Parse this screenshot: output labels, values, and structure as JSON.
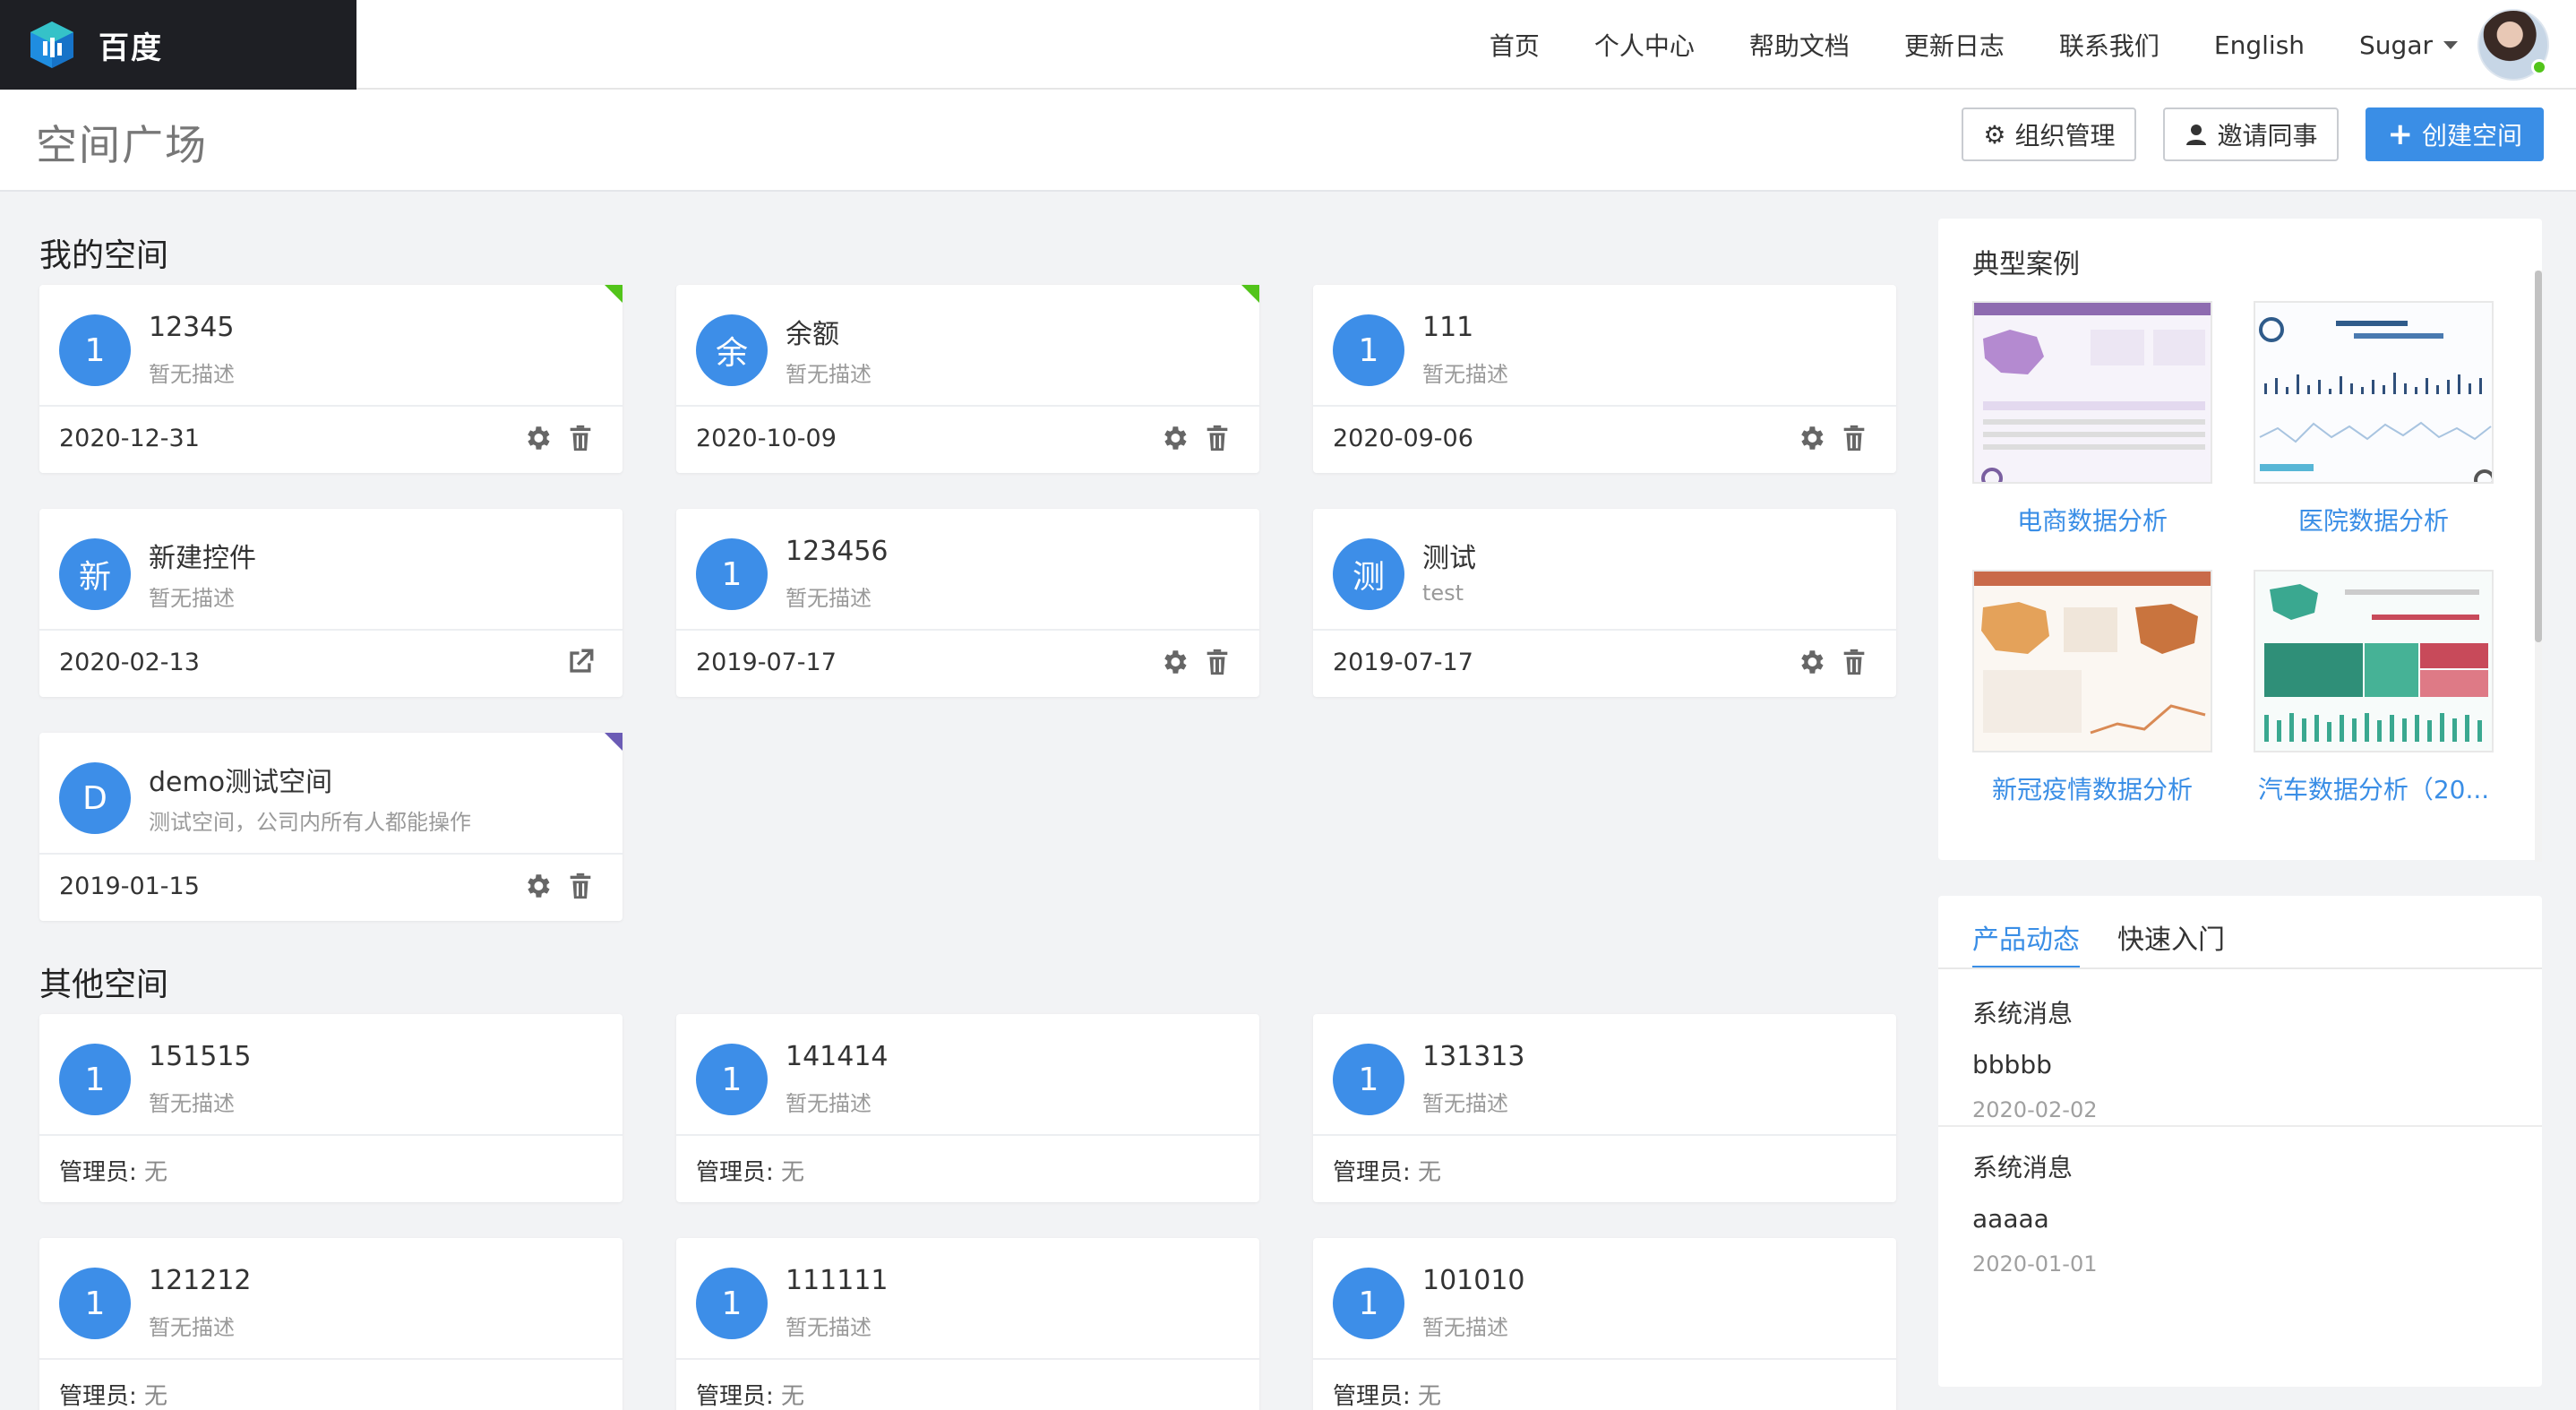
{
  "app": {
    "brand": "百度",
    "nav": [
      "首页",
      "个人中心",
      "帮助文档",
      "更新日志",
      "联系我们",
      "English"
    ],
    "user": "Sugar"
  },
  "header": {
    "title": "空间广场",
    "buttons": {
      "org": "组织管理",
      "invite": "邀请同事",
      "create": "创建空间"
    }
  },
  "my_spaces": {
    "title": "我的空间",
    "cards": [
      {
        "avatar": "1",
        "name": "12345",
        "desc": "暂无描述",
        "date": "2020-12-31",
        "corner": "green",
        "actions": "settings-delete"
      },
      {
        "avatar": "余",
        "name": "余额",
        "desc": "暂无描述",
        "date": "2020-10-09",
        "corner": "green",
        "actions": "settings-delete"
      },
      {
        "avatar": "1",
        "name": "111",
        "desc": "暂无描述",
        "date": "2020-09-06",
        "corner": "",
        "actions": "settings-delete"
      },
      {
        "avatar": "新",
        "name": "新建控件",
        "desc": "暂无描述",
        "date": "2020-02-13",
        "corner": "",
        "actions": "external"
      },
      {
        "avatar": "1",
        "name": "123456",
        "desc": "暂无描述",
        "date": "2019-07-17",
        "corner": "",
        "actions": "settings-delete"
      },
      {
        "avatar": "测",
        "name": "测试",
        "desc": "test",
        "date": "2019-07-17",
        "corner": "",
        "actions": "settings-delete"
      },
      {
        "avatar": "D",
        "name": "demo测试空间",
        "desc": "测试空间，公司内所有人都能操作",
        "date": "2019-01-15",
        "corner": "purple",
        "actions": "settings-delete"
      }
    ]
  },
  "other_spaces": {
    "title": "其他空间",
    "admin_label": "管理员:",
    "cards": [
      {
        "avatar": "1",
        "name": "151515",
        "desc": "暂无描述",
        "admin": "无"
      },
      {
        "avatar": "1",
        "name": "141414",
        "desc": "暂无描述",
        "admin": "无"
      },
      {
        "avatar": "1",
        "name": "131313",
        "desc": "暂无描述",
        "admin": "无"
      },
      {
        "avatar": "1",
        "name": "121212",
        "desc": "暂无描述",
        "admin": "无"
      },
      {
        "avatar": "1",
        "name": "111111",
        "desc": "暂无描述",
        "admin": "无"
      },
      {
        "avatar": "1",
        "name": "101010",
        "desc": "暂无描述",
        "admin": "无"
      }
    ]
  },
  "cases": {
    "title": "典型案例",
    "items": [
      "电商数据分析",
      "医院数据分析",
      "新冠疫情数据分析",
      "汽车数据分析（20..."
    ]
  },
  "news": {
    "tabs": [
      "产品动态",
      "快速入门"
    ],
    "items": [
      {
        "type": "系统消息",
        "text": "bbbbb",
        "date": "2020-02-02"
      },
      {
        "type": "系统消息",
        "text": "aaaaa",
        "date": "2020-01-01"
      }
    ]
  },
  "colors": {
    "primary": "#3a8ee6",
    "avatar": "#3d8ee8",
    "brand_bg": "#1e1f24"
  }
}
